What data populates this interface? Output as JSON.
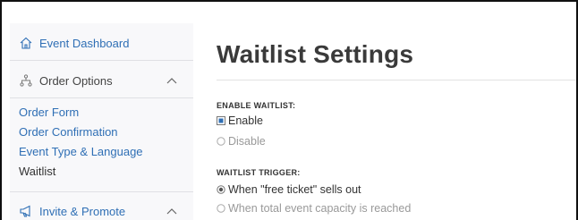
{
  "sidebar": {
    "dashboard_label": "Event Dashboard",
    "order_options_label": "Order Options",
    "sub_items": [
      "Order Form",
      "Order Confirmation",
      "Event Type & Language",
      "Waitlist"
    ],
    "invite_label": "Invite & Promote"
  },
  "main": {
    "title": "Waitlist Settings",
    "enable_section": {
      "label": "ENABLE WAITLIST:",
      "options": [
        "Enable",
        "Disable"
      ],
      "selected": "Enable"
    },
    "trigger_section": {
      "label": "WAITLIST TRIGGER:",
      "options": [
        "When \"free ticket\" sells out",
        "When total event capacity is reached"
      ],
      "selected": "When \"free ticket\" sells out"
    }
  },
  "colors": {
    "link": "#2f6fb5",
    "sidebar_bg": "#f8f8fa",
    "text": "#333333",
    "muted": "#999999"
  }
}
